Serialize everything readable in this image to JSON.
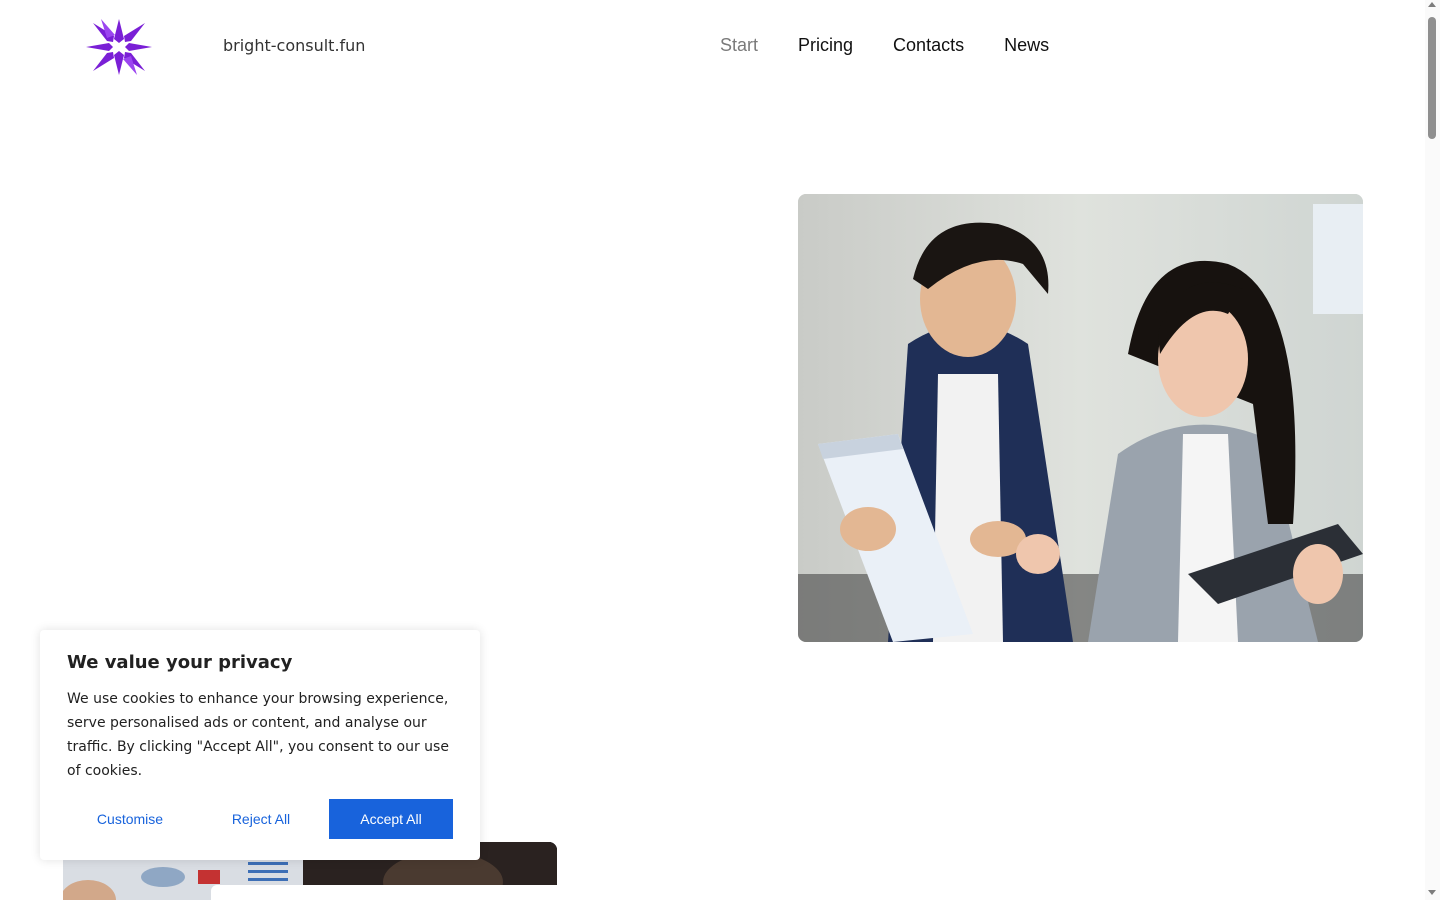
{
  "header": {
    "site_name": "bright-consult.fun",
    "nav": [
      {
        "label": "Start",
        "active": true
      },
      {
        "label": "Pricing",
        "active": false
      },
      {
        "label": "Contacts",
        "active": false
      },
      {
        "label": "News",
        "active": false
      }
    ]
  },
  "hero": {
    "image_icon": "photo-business-meeting"
  },
  "cookie_banner": {
    "title": "We value your privacy",
    "text": "We use cookies to enhance your browsing experience, serve personalised ads or content, and analyse our traffic. By clicking \"Accept All\", you consent to our use of cookies.",
    "customise_label": "Customise",
    "reject_label": "Reject All",
    "accept_label": "Accept All"
  },
  "colors": {
    "brand_purple": "#7a1fd6",
    "accent_blue": "#1863dc",
    "nav_active": "#7a7a7a"
  }
}
